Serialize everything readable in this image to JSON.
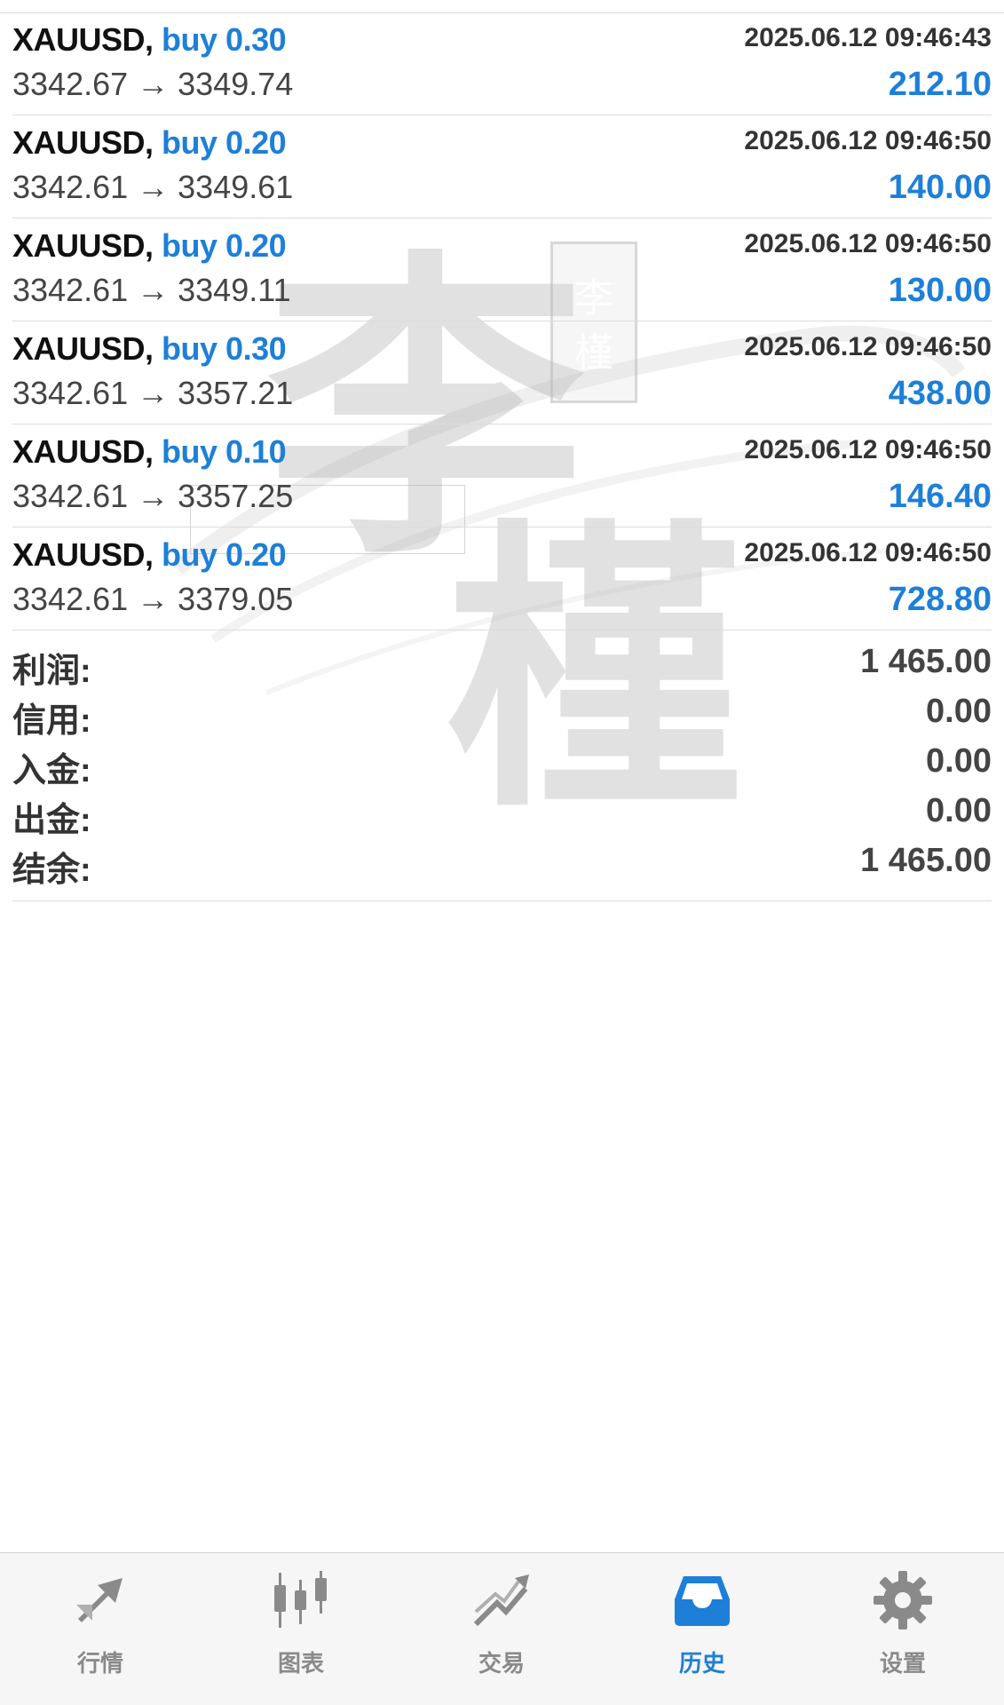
{
  "trades": [
    {
      "symbol": "XAUUSD,",
      "side": "buy 0.30",
      "time": "2025.06.12 09:46:43",
      "prices": "3342.67 → 3349.74",
      "profit": "212.10"
    },
    {
      "symbol": "XAUUSD,",
      "side": "buy 0.20",
      "time": "2025.06.12 09:46:50",
      "prices": "3342.61 → 3349.61",
      "profit": "140.00"
    },
    {
      "symbol": "XAUUSD,",
      "side": "buy 0.20",
      "time": "2025.06.12 09:46:50",
      "prices": "3342.61 → 3349.11",
      "profit": "130.00"
    },
    {
      "symbol": "XAUUSD,",
      "side": "buy 0.30",
      "time": "2025.06.12 09:46:50",
      "prices": "3342.61 → 3357.21",
      "profit": "438.00"
    },
    {
      "symbol": "XAUUSD,",
      "side": "buy 0.10",
      "time": "2025.06.12 09:46:50",
      "prices": "3342.61 → 3357.25",
      "profit": "146.40"
    },
    {
      "symbol": "XAUUSD,",
      "side": "buy 0.20",
      "time": "2025.06.12 09:46:50",
      "prices": "3342.61 → 3379.05",
      "profit": "728.80"
    }
  ],
  "summary": [
    {
      "label": "利润:",
      "value": "1 465.00"
    },
    {
      "label": "信用:",
      "value": "0.00"
    },
    {
      "label": "入金:",
      "value": "0.00"
    },
    {
      "label": "出金:",
      "value": "0.00"
    },
    {
      "label": "结余:",
      "value": "1 465.00"
    }
  ],
  "watermark": {
    "char1": "李",
    "char2": "槿",
    "seal1": "李",
    "seal2": "槿"
  },
  "tabbar": {
    "tabs": [
      {
        "label": "行情",
        "icon": "quotes-arrows-icon",
        "active": false
      },
      {
        "label": "图表",
        "icon": "candlestick-chart-icon",
        "active": false
      },
      {
        "label": "交易",
        "icon": "trade-trend-icon",
        "active": false
      },
      {
        "label": "历史",
        "icon": "history-tray-icon",
        "active": true
      },
      {
        "label": "设置",
        "icon": "gear-icon",
        "active": false
      }
    ]
  },
  "colors": {
    "accent": "#1e7fd8",
    "inactive": "#8a8a8a",
    "text": "#111111"
  }
}
